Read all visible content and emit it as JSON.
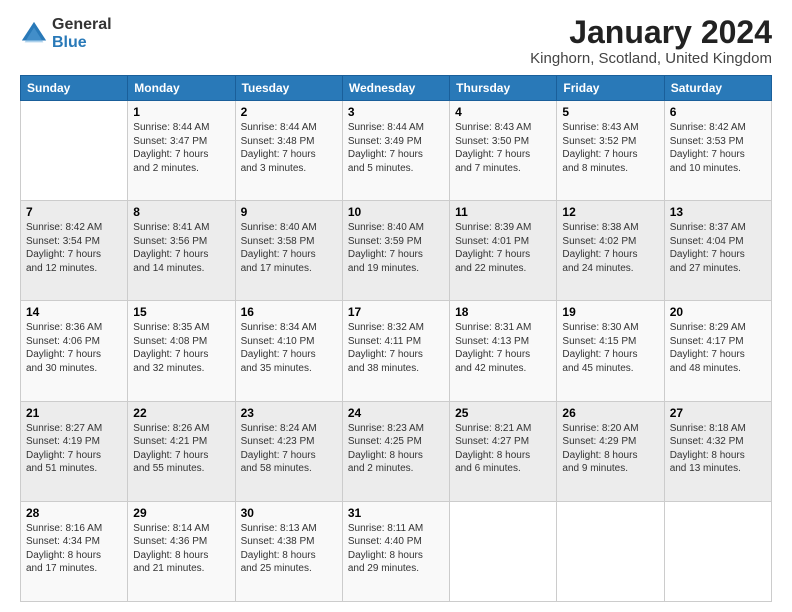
{
  "logo": {
    "general": "General",
    "blue": "Blue"
  },
  "title": "January 2024",
  "location": "Kinghorn, Scotland, United Kingdom",
  "days_of_week": [
    "Sunday",
    "Monday",
    "Tuesday",
    "Wednesday",
    "Thursday",
    "Friday",
    "Saturday"
  ],
  "weeks": [
    [
      {
        "day": "",
        "info": ""
      },
      {
        "day": "1",
        "info": "Sunrise: 8:44 AM\nSunset: 3:47 PM\nDaylight: 7 hours\nand 2 minutes."
      },
      {
        "day": "2",
        "info": "Sunrise: 8:44 AM\nSunset: 3:48 PM\nDaylight: 7 hours\nand 3 minutes."
      },
      {
        "day": "3",
        "info": "Sunrise: 8:44 AM\nSunset: 3:49 PM\nDaylight: 7 hours\nand 5 minutes."
      },
      {
        "day": "4",
        "info": "Sunrise: 8:43 AM\nSunset: 3:50 PM\nDaylight: 7 hours\nand 7 minutes."
      },
      {
        "day": "5",
        "info": "Sunrise: 8:43 AM\nSunset: 3:52 PM\nDaylight: 7 hours\nand 8 minutes."
      },
      {
        "day": "6",
        "info": "Sunrise: 8:42 AM\nSunset: 3:53 PM\nDaylight: 7 hours\nand 10 minutes."
      }
    ],
    [
      {
        "day": "7",
        "info": "Sunrise: 8:42 AM\nSunset: 3:54 PM\nDaylight: 7 hours\nand 12 minutes."
      },
      {
        "day": "8",
        "info": "Sunrise: 8:41 AM\nSunset: 3:56 PM\nDaylight: 7 hours\nand 14 minutes."
      },
      {
        "day": "9",
        "info": "Sunrise: 8:40 AM\nSunset: 3:58 PM\nDaylight: 7 hours\nand 17 minutes."
      },
      {
        "day": "10",
        "info": "Sunrise: 8:40 AM\nSunset: 3:59 PM\nDaylight: 7 hours\nand 19 minutes."
      },
      {
        "day": "11",
        "info": "Sunrise: 8:39 AM\nSunset: 4:01 PM\nDaylight: 7 hours\nand 22 minutes."
      },
      {
        "day": "12",
        "info": "Sunrise: 8:38 AM\nSunset: 4:02 PM\nDaylight: 7 hours\nand 24 minutes."
      },
      {
        "day": "13",
        "info": "Sunrise: 8:37 AM\nSunset: 4:04 PM\nDaylight: 7 hours\nand 27 minutes."
      }
    ],
    [
      {
        "day": "14",
        "info": "Sunrise: 8:36 AM\nSunset: 4:06 PM\nDaylight: 7 hours\nand 30 minutes."
      },
      {
        "day": "15",
        "info": "Sunrise: 8:35 AM\nSunset: 4:08 PM\nDaylight: 7 hours\nand 32 minutes."
      },
      {
        "day": "16",
        "info": "Sunrise: 8:34 AM\nSunset: 4:10 PM\nDaylight: 7 hours\nand 35 minutes."
      },
      {
        "day": "17",
        "info": "Sunrise: 8:32 AM\nSunset: 4:11 PM\nDaylight: 7 hours\nand 38 minutes."
      },
      {
        "day": "18",
        "info": "Sunrise: 8:31 AM\nSunset: 4:13 PM\nDaylight: 7 hours\nand 42 minutes."
      },
      {
        "day": "19",
        "info": "Sunrise: 8:30 AM\nSunset: 4:15 PM\nDaylight: 7 hours\nand 45 minutes."
      },
      {
        "day": "20",
        "info": "Sunrise: 8:29 AM\nSunset: 4:17 PM\nDaylight: 7 hours\nand 48 minutes."
      }
    ],
    [
      {
        "day": "21",
        "info": "Sunrise: 8:27 AM\nSunset: 4:19 PM\nDaylight: 7 hours\nand 51 minutes."
      },
      {
        "day": "22",
        "info": "Sunrise: 8:26 AM\nSunset: 4:21 PM\nDaylight: 7 hours\nand 55 minutes."
      },
      {
        "day": "23",
        "info": "Sunrise: 8:24 AM\nSunset: 4:23 PM\nDaylight: 7 hours\nand 58 minutes."
      },
      {
        "day": "24",
        "info": "Sunrise: 8:23 AM\nSunset: 4:25 PM\nDaylight: 8 hours\nand 2 minutes."
      },
      {
        "day": "25",
        "info": "Sunrise: 8:21 AM\nSunset: 4:27 PM\nDaylight: 8 hours\nand 6 minutes."
      },
      {
        "day": "26",
        "info": "Sunrise: 8:20 AM\nSunset: 4:29 PM\nDaylight: 8 hours\nand 9 minutes."
      },
      {
        "day": "27",
        "info": "Sunrise: 8:18 AM\nSunset: 4:32 PM\nDaylight: 8 hours\nand 13 minutes."
      }
    ],
    [
      {
        "day": "28",
        "info": "Sunrise: 8:16 AM\nSunset: 4:34 PM\nDaylight: 8 hours\nand 17 minutes."
      },
      {
        "day": "29",
        "info": "Sunrise: 8:14 AM\nSunset: 4:36 PM\nDaylight: 8 hours\nand 21 minutes."
      },
      {
        "day": "30",
        "info": "Sunrise: 8:13 AM\nSunset: 4:38 PM\nDaylight: 8 hours\nand 25 minutes."
      },
      {
        "day": "31",
        "info": "Sunrise: 8:11 AM\nSunset: 4:40 PM\nDaylight: 8 hours\nand 29 minutes."
      },
      {
        "day": "",
        "info": ""
      },
      {
        "day": "",
        "info": ""
      },
      {
        "day": "",
        "info": ""
      }
    ]
  ]
}
